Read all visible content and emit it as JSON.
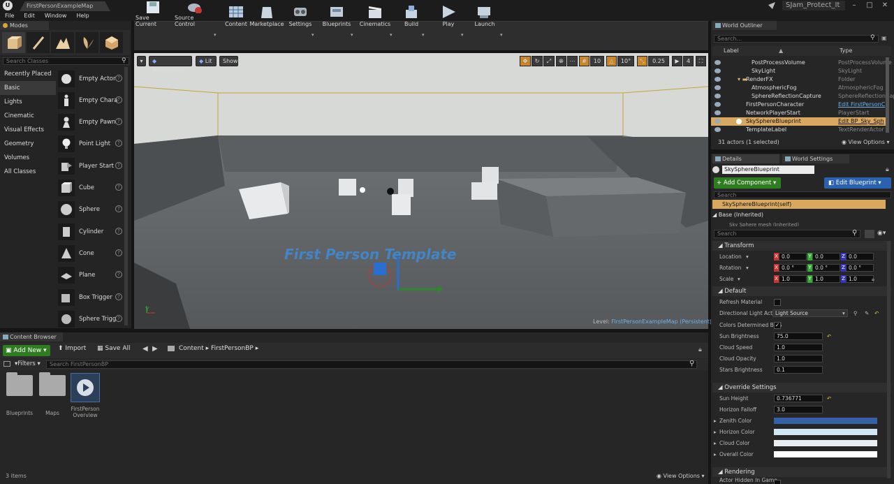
{
  "app": {
    "doc_tab": "FirstPersonExampleMap",
    "project": "SJam_Protect_It"
  },
  "menu": [
    "File",
    "Edit",
    "Window",
    "Help"
  ],
  "modes": {
    "title": "Modes",
    "search_placeholder": "Search Classes",
    "categories": [
      "Recently Placed",
      "Basic",
      "Lights",
      "Cinematic",
      "Visual Effects",
      "Geometry",
      "Volumes",
      "All Classes"
    ],
    "items": [
      "Empty Actor",
      "Empty Chara",
      "Empty Pawn",
      "Point Light",
      "Player Start",
      "Cube",
      "Sphere",
      "Cylinder",
      "Cone",
      "Plane",
      "Box Trigger",
      "Sphere Trigg"
    ]
  },
  "toolbar": [
    "Save Current",
    "Source Control",
    "Content",
    "Marketplace",
    "Settings",
    "Blueprints",
    "Cinematics",
    "Build",
    "Play",
    "Launch"
  ],
  "viewport": {
    "perspective": "Perspective",
    "lit": "Lit",
    "show": "Show",
    "snap_grid": "10",
    "snap_rot": "10°",
    "snap_scale": "0.25",
    "cam_speed": "4",
    "level_label": "Level:",
    "level_name": "FirstPersonExampleMap (Persistent)",
    "template_text": "First Person Template"
  },
  "content_browser": {
    "tab": "Content Browser",
    "add_new": "Add New",
    "import": "Import",
    "save_all": "Save All",
    "path": [
      "Content",
      "FirstPersonBP"
    ],
    "filters": "Filters",
    "search_placeholder": "Search FirstPersonBP",
    "assets": [
      "Blueprints",
      "Maps",
      "FirstPerson Overview"
    ],
    "count": "3 items",
    "view_options": "View Options"
  },
  "outliner": {
    "tab": "World Outliner",
    "search_placeholder": "Search...",
    "col_label": "Label",
    "col_type": "Type",
    "rows": [
      {
        "label": "PostProcessVolume",
        "type": "PostProcessVolume"
      },
      {
        "label": "SkyLight",
        "type": "SkyLight"
      },
      {
        "label": "RenderFX",
        "type": "Folder"
      },
      {
        "label": "AtmosphericFog",
        "type": "AtmosphericFog"
      },
      {
        "label": "SphereReflectionCapture",
        "type": "SphereReflectionCaptu"
      },
      {
        "label": "FirstPersonCharacter",
        "type": "Edit FirstPersonC"
      },
      {
        "label": "NetworkPlayerStart",
        "type": "PlayerStart"
      },
      {
        "label": "SkySphereBlueprint",
        "type": "Edit BP_Sky_Sph"
      },
      {
        "label": "TemplateLabel",
        "type": "TextRenderActor"
      }
    ],
    "footer": "31 actors (1 selected)",
    "view_options": "View Options"
  },
  "details": {
    "tab": "Details",
    "tab2": "World Settings",
    "name": "SkySphereBlueprint",
    "add_component": "+ Add Component",
    "edit_blueprint": "Edit Blueprint",
    "search_placeholder": "Search",
    "self": "SkySphereBlueprint(self)",
    "base": "Base (Inherited)",
    "base_child": "Sky Sphere mesh (Inherited)",
    "search2": "Search",
    "transform": "Transform",
    "location": "Location",
    "rotation": "Rotation",
    "scale": "Scale",
    "loc": [
      "0.0",
      "0.0",
      "0.0"
    ],
    "rot": [
      "0.0 °",
      "0.0 °",
      "0.0 °"
    ],
    "scl": [
      "1.0",
      "1.0",
      "1.0"
    ],
    "default": "Default",
    "refresh_material": "Refresh Material",
    "dir_light": "Directional Light Actor",
    "dir_light_value": "Light Source",
    "colors_determined": "Colors Determined By S",
    "sun_brightness": "Sun Brightness",
    "sun_brightness_val": "75.0",
    "cloud_speed": "Cloud Speed",
    "cloud_speed_val": "1.0",
    "cloud_opacity": "Cloud Opacity",
    "cloud_opacity_val": "1.0",
    "stars_brightness": "Stars Brightness",
    "stars_brightness_val": "0.1",
    "override": "Override Settings",
    "sun_height": "Sun Height",
    "sun_height_val": "0.736771",
    "horizon_falloff": "Horizon Falloff",
    "horizon_falloff_val": "3.0",
    "zenith": "Zenith Color",
    "horizon_color": "Horizon Color",
    "cloud_color": "Cloud Color",
    "overall_color": "Overall Color",
    "rendering": "Rendering",
    "actor_hidden": "Actor Hidden In Game",
    "colors": {
      "zenith": "#3460a8",
      "horizon": "#cfe6f5",
      "cloud": "#e8eef2",
      "overall": "#ffffff"
    }
  }
}
